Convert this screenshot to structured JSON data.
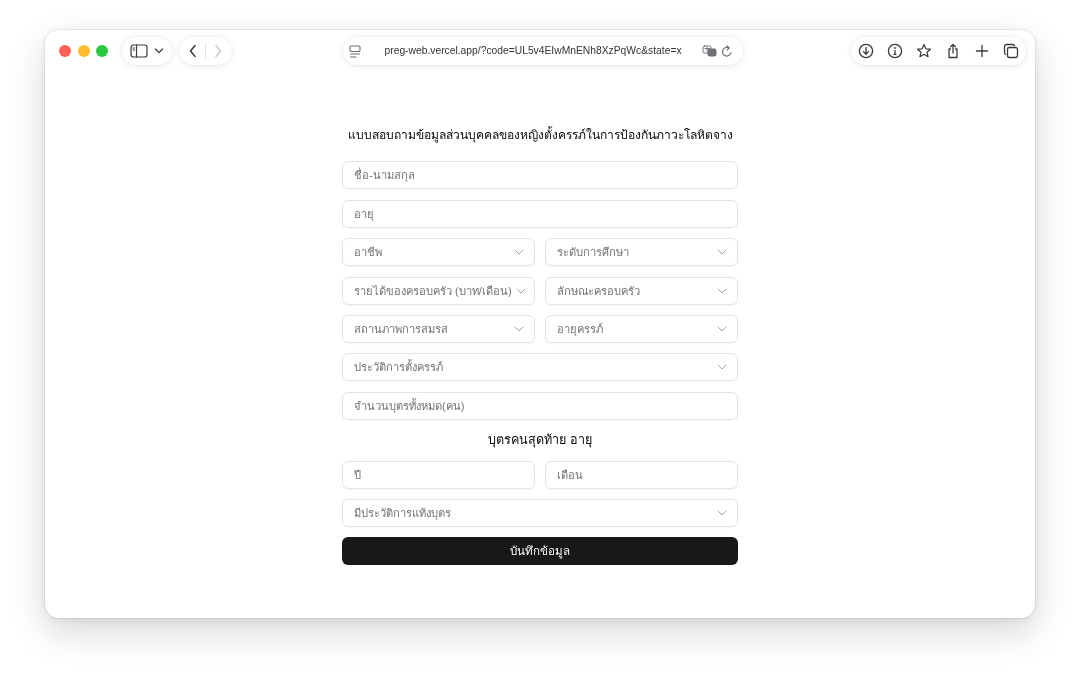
{
  "browser": {
    "url": "preg-web.vercel.app/?code=UL5v4EIwMnENh8XzPqWc&state=x",
    "back": {
      "disabled": false
    },
    "forward": {
      "disabled": true
    }
  },
  "form": {
    "title": "แบบสอบถามข้อมูลส่วนบุคคลของหญิงตั้งครรภ์ในการป้องกันภาวะโลหิตจาง",
    "items": [
      {
        "kind": "row",
        "fields": [
          {
            "kind": "input",
            "placeholder": "ชื่อ-นามสกุล"
          }
        ]
      },
      {
        "kind": "row",
        "fields": [
          {
            "kind": "input",
            "placeholder": "อายุ"
          }
        ]
      },
      {
        "kind": "row",
        "fields": [
          {
            "kind": "select",
            "placeholder": "อาชีพ"
          },
          {
            "kind": "select",
            "placeholder": "ระดับการศึกษา"
          }
        ]
      },
      {
        "kind": "row",
        "fields": [
          {
            "kind": "select",
            "placeholder": "รายได้ของครอบครัว (บาท/เดือน)"
          },
          {
            "kind": "select",
            "placeholder": "ลักษณะครอบครัว"
          }
        ]
      },
      {
        "kind": "row",
        "fields": [
          {
            "kind": "select",
            "placeholder": "สถานภาพการสมรส"
          },
          {
            "kind": "select",
            "placeholder": "อายุครรภ์"
          }
        ]
      },
      {
        "kind": "row",
        "fields": [
          {
            "kind": "select",
            "placeholder": "ประวัติการตั้งครรภ์"
          }
        ]
      },
      {
        "kind": "row",
        "fields": [
          {
            "kind": "input",
            "placeholder": "จำนวนบุตรทั้งหมด(คน)"
          }
        ]
      },
      {
        "kind": "heading",
        "text": "บุตรคนสุดท้าย อายุ"
      },
      {
        "kind": "row",
        "fields": [
          {
            "kind": "input",
            "placeholder": "ปี"
          },
          {
            "kind": "input",
            "placeholder": "เดือน"
          }
        ]
      },
      {
        "kind": "row",
        "fields": [
          {
            "kind": "select",
            "placeholder": "มีประวัติการแท้งบุตร"
          }
        ]
      },
      {
        "kind": "button",
        "label": "บันทึกข้อมูล"
      }
    ]
  }
}
